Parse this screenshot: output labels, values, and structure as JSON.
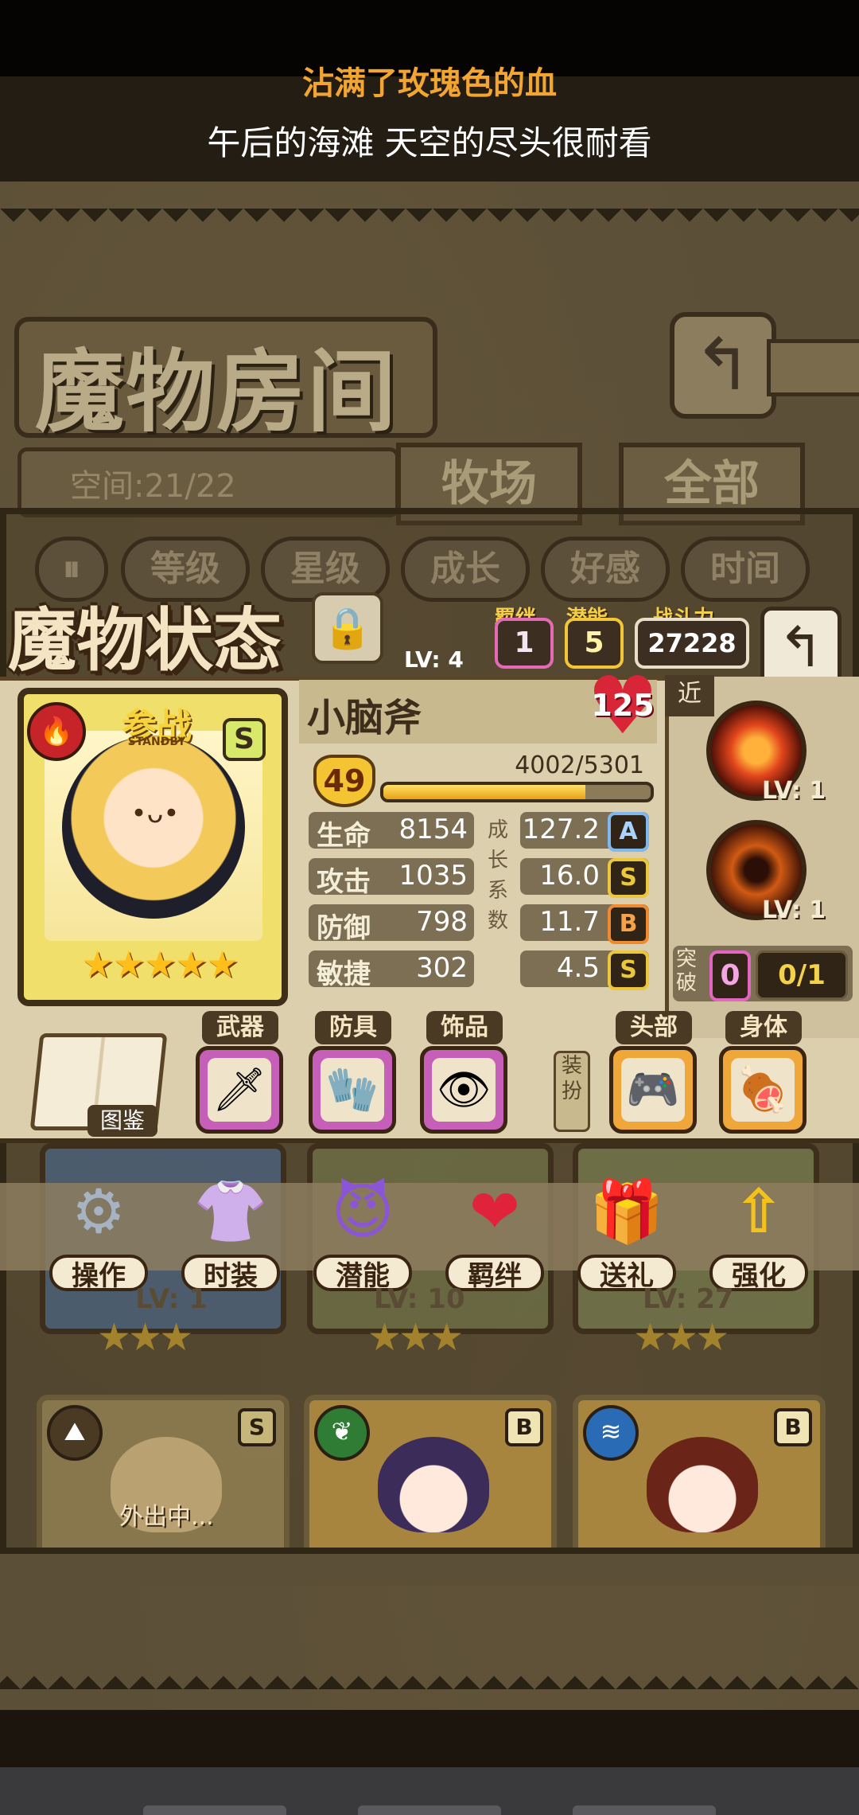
{
  "lyrics": {
    "line1": "沾满了玫瑰色的血",
    "line2": "午后的海滩 天空的尽头很耐看"
  },
  "room": {
    "title": "魔物房间",
    "space": "空间:21/22",
    "tabs": [
      "牧场",
      "全部"
    ],
    "sort_buttons": [
      "等级",
      "星级",
      "成长",
      "好感",
      "时间"
    ]
  },
  "status": {
    "title": "魔物状态",
    "chips": {
      "bond_label": "羁绊",
      "bond_value": "1",
      "potential_label": "潜能",
      "potential_value": "5",
      "power_label": "战斗力",
      "power_value": "27228"
    },
    "card": {
      "standby": "参战",
      "standby_sub": "STANDBY",
      "grade": "S",
      "stars": "★★★★★"
    },
    "name": "小脑斧",
    "affection": "125",
    "level": "49",
    "exp": "4002/5301",
    "exp_fraction": 0.755,
    "growth_label": "成长系数",
    "stats": [
      {
        "label": "生命",
        "value": "8154",
        "growth": "127.2",
        "grade": "A"
      },
      {
        "label": "攻击",
        "value": "1035",
        "growth": "16.0",
        "grade": "S"
      },
      {
        "label": "防御",
        "value": "798",
        "growth": "11.7",
        "grade": "B"
      },
      {
        "label": "敏捷",
        "value": "302",
        "growth": "4.5",
        "grade": "S"
      }
    ],
    "range_tag": "近",
    "skills": [
      {
        "level": "LV: 1",
        "icon": "tiger-skill-icon"
      },
      {
        "level": "LV: 1",
        "icon": "vortex-skill-icon"
      }
    ],
    "breakthrough": {
      "label": "突破",
      "count": "0",
      "progress": "0/1"
    }
  },
  "equipment": {
    "encyclopedia": "图鉴",
    "dress_label": "装扮",
    "slots": [
      {
        "label": "武器",
        "icon": "🗡"
      },
      {
        "label": "防具",
        "icon": "🧤"
      },
      {
        "label": "饰品",
        "icon": "👁"
      },
      {
        "label": "头部",
        "icon": "🎮"
      },
      {
        "label": "身体",
        "icon": "🍖"
      }
    ]
  },
  "actions": [
    {
      "label": "操作",
      "icon": "⚙"
    },
    {
      "label": "时装",
      "icon": "👚"
    },
    {
      "label": "潜能",
      "icon": "😈"
    },
    {
      "label": "羁绊",
      "icon": "❤"
    },
    {
      "label": "送礼",
      "icon": "🎁"
    },
    {
      "label": "强化",
      "icon": "⇧"
    }
  ],
  "background_cards": {
    "levels": [
      "LV: 1",
      "LV: 10",
      "LV: 27"
    ],
    "stars": "★★★",
    "peek_level": "LV: 4",
    "outing": "外出中...",
    "grades": [
      "S",
      "B",
      "B"
    ]
  }
}
